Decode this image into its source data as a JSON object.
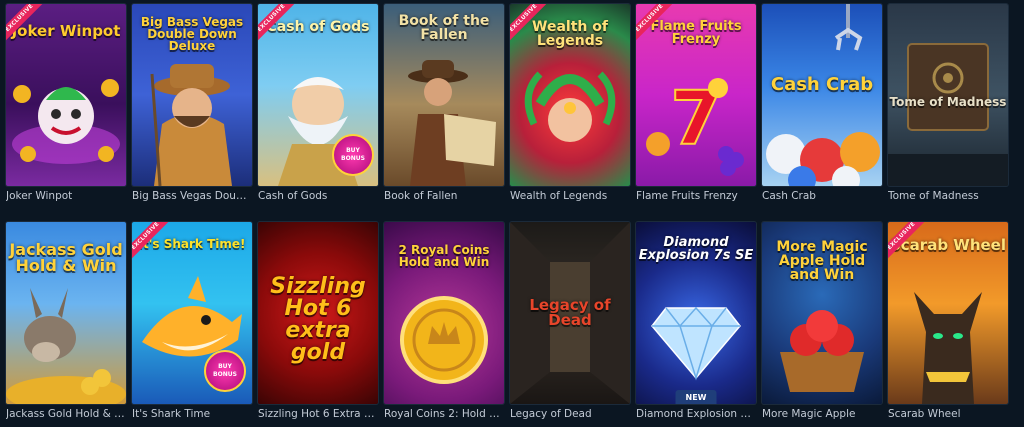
{
  "ribbon_text": "EXCLUSIVE",
  "new_badge": "NEW",
  "bonus_text": "BUY BONUS",
  "games": [
    {
      "title": "Joker Winpot",
      "logo": "Joker Winpot",
      "exclusive": true
    },
    {
      "title": "Big Bass Vegas Double D...",
      "logo": "Big Bass Vegas Double Down Deluxe",
      "exclusive": false
    },
    {
      "title": "Cash of Gods",
      "logo": "Cash of Gods",
      "exclusive": true
    },
    {
      "title": "Book of Fallen",
      "logo": "Book of the Fallen",
      "exclusive": false
    },
    {
      "title": "Wealth of Legends",
      "logo": "Wealth of Legends",
      "exclusive": true
    },
    {
      "title": "Flame Fruits Frenzy",
      "logo": "Flame Fruits Frenzy",
      "exclusive": true
    },
    {
      "title": "Cash Crab",
      "logo": "Cash Crab",
      "exclusive": false
    },
    {
      "title": "Tome of Madness",
      "logo": "Tome of Madness",
      "exclusive": false
    },
    {
      "title": "Jackass Gold Hold & Win",
      "logo": "Jackass Gold Hold & Win",
      "exclusive": false
    },
    {
      "title": "It's Shark Time",
      "logo": "It's Shark Time!",
      "exclusive": true
    },
    {
      "title": "Sizzling Hot 6 Extra Gold",
      "logo": "Sizzling Hot 6 extra gold",
      "exclusive": false
    },
    {
      "title": "Royal Coins 2: Hold and ...",
      "logo": "2 Royal Coins Hold and Win",
      "exclusive": false
    },
    {
      "title": "Legacy of Dead",
      "logo": "Legacy of Dead",
      "exclusive": false
    },
    {
      "title": "Diamond Explosion 7s SE",
      "logo": "Diamond Explosion 7s SE",
      "exclusive": false
    },
    {
      "title": "More Magic Apple",
      "logo": "More Magic Apple Hold and Win",
      "exclusive": false
    },
    {
      "title": "Scarab Wheel",
      "logo": "Scarab Wheel",
      "exclusive": true
    }
  ]
}
